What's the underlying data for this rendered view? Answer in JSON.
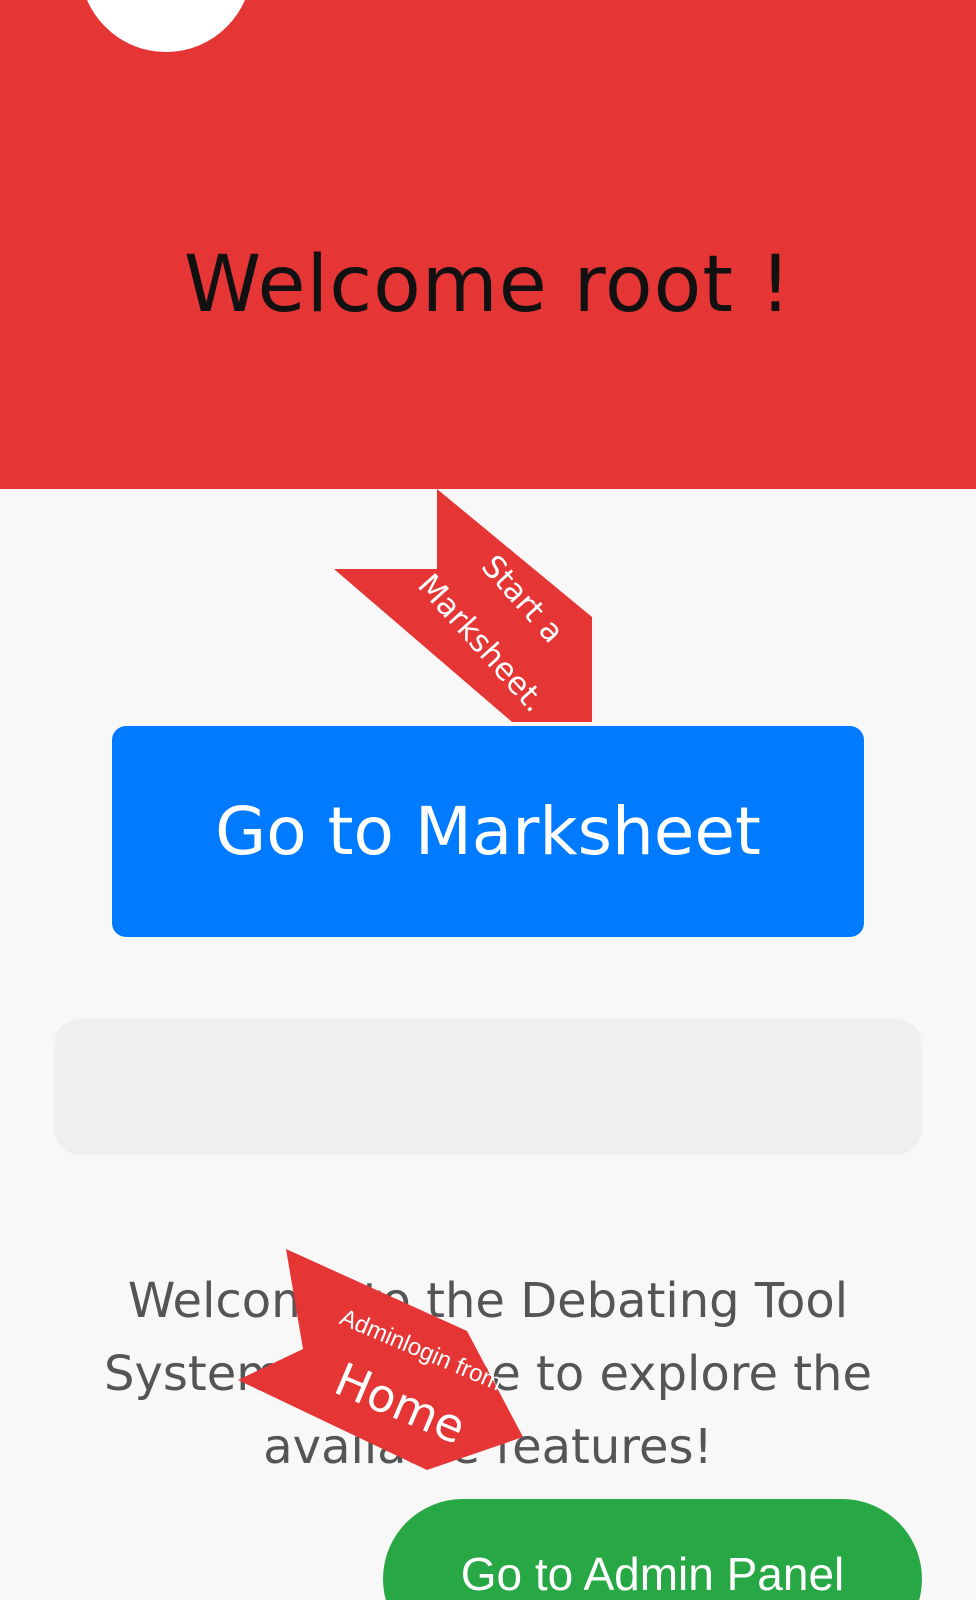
{
  "header": {
    "title": "Welcome root !"
  },
  "main": {
    "marksheet_button_label": "Go to Marksheet",
    "intro_text": "Welcome to the Debating Tool System. Feel free to explore the available features!",
    "admin_button_label": "Go to Admin Panel"
  },
  "annotations": {
    "marksheet_line1": "Start a",
    "marksheet_line2": "Marksheet.",
    "admin_line1": "Adminlogin from",
    "admin_line2": "Home"
  },
  "colors": {
    "hero": "#e53535",
    "primary": "#007bff",
    "success": "#28a745",
    "annotation": "#e53535"
  }
}
